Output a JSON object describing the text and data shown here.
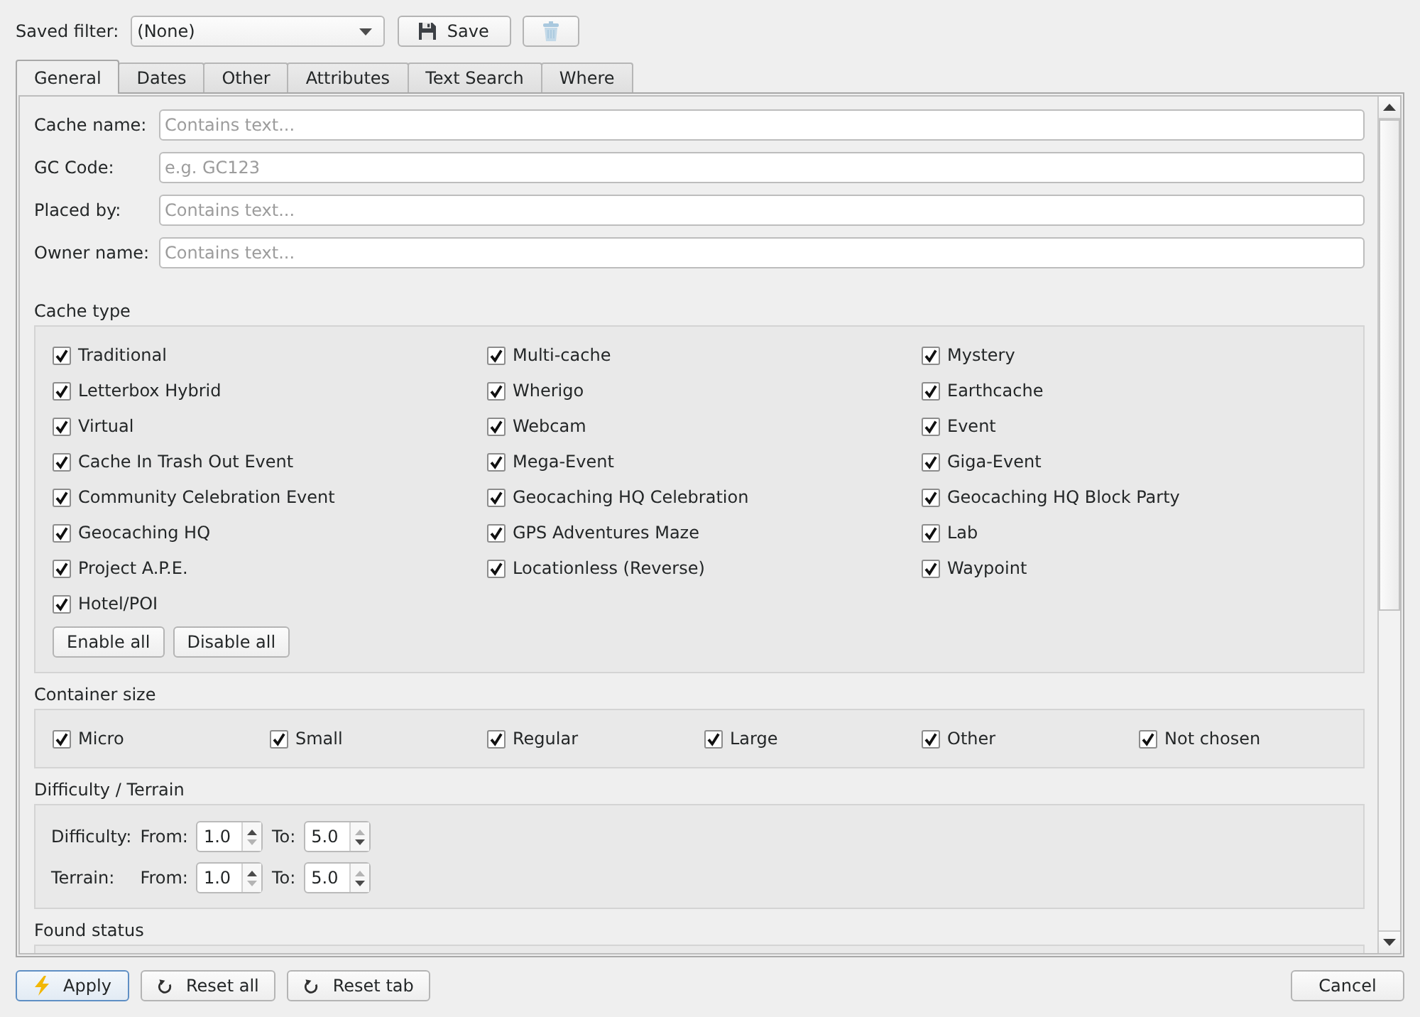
{
  "saved_filter": {
    "label": "Saved filter:",
    "value": "(None)",
    "save_label": "Save",
    "delete_disabled": true
  },
  "tabs": [
    {
      "label": "General",
      "selected": true
    },
    {
      "label": "Dates",
      "selected": false
    },
    {
      "label": "Other",
      "selected": false
    },
    {
      "label": "Attributes",
      "selected": false
    },
    {
      "label": "Text Search",
      "selected": false
    },
    {
      "label": "Where",
      "selected": false
    }
  ],
  "text_fields": [
    {
      "label": "Cache name:",
      "placeholder": "Contains text..."
    },
    {
      "label": "GC Code:",
      "placeholder": "e.g. GC123"
    },
    {
      "label": "Placed by:",
      "placeholder": "Contains text..."
    },
    {
      "label": "Owner name:",
      "placeholder": "Contains text..."
    }
  ],
  "cache_type": {
    "title": "Cache type",
    "options": [
      {
        "label": "Traditional",
        "checked": true
      },
      {
        "label": "Multi-cache",
        "checked": true
      },
      {
        "label": "Mystery",
        "checked": true
      },
      {
        "label": "Letterbox Hybrid",
        "checked": true
      },
      {
        "label": "Wherigo",
        "checked": true
      },
      {
        "label": "Earthcache",
        "checked": true
      },
      {
        "label": "Virtual",
        "checked": true
      },
      {
        "label": "Webcam",
        "checked": true
      },
      {
        "label": "Event",
        "checked": true
      },
      {
        "label": "Cache In Trash Out Event",
        "checked": true
      },
      {
        "label": "Mega-Event",
        "checked": true
      },
      {
        "label": "Giga-Event",
        "checked": true
      },
      {
        "label": "Community Celebration Event",
        "checked": true
      },
      {
        "label": "Geocaching HQ Celebration",
        "checked": true
      },
      {
        "label": "Geocaching HQ Block Party",
        "checked": true
      },
      {
        "label": "Geocaching HQ",
        "checked": true
      },
      {
        "label": "GPS Adventures Maze",
        "checked": true
      },
      {
        "label": "Lab",
        "checked": true
      },
      {
        "label": "Project A.P.E.",
        "checked": true
      },
      {
        "label": "Locationless (Reverse)",
        "checked": true
      },
      {
        "label": "Waypoint",
        "checked": true
      },
      {
        "label": "Hotel/POI",
        "checked": true
      }
    ],
    "buttons": [
      "Enable all",
      "Disable all"
    ]
  },
  "container_size": {
    "title": "Container size",
    "options": [
      {
        "label": "Micro",
        "checked": true
      },
      {
        "label": "Small",
        "checked": true
      },
      {
        "label": "Regular",
        "checked": true
      },
      {
        "label": "Large",
        "checked": true
      },
      {
        "label": "Other",
        "checked": true
      },
      {
        "label": "Not chosen",
        "checked": true
      }
    ]
  },
  "difficulty_terrain": {
    "title": "Difficulty / Terrain",
    "rows": [
      {
        "label": "Difficulty:",
        "from_label": "From:",
        "from": {
          "value": "1.0",
          "up_enabled": true,
          "down_enabled": false
        },
        "to_label": "To:",
        "to": {
          "value": "5.0",
          "up_enabled": false,
          "down_enabled": true
        }
      },
      {
        "label": "Terrain:",
        "from_label": "From:",
        "from": {
          "value": "1.0",
          "up_enabled": true,
          "down_enabled": false
        },
        "to_label": "To:",
        "to": {
          "value": "5.0",
          "up_enabled": false,
          "down_enabled": true
        }
      }
    ]
  },
  "found_status": {
    "title": "Found status"
  },
  "buttons": [
    {
      "kind": "apply",
      "label": "Apply",
      "default": true
    },
    {
      "kind": "reset",
      "label": "Reset all",
      "default": false
    },
    {
      "kind": "reset",
      "label": "Reset tab",
      "default": false
    },
    {
      "kind": "cancel",
      "label": "Cancel",
      "default": false
    }
  ]
}
